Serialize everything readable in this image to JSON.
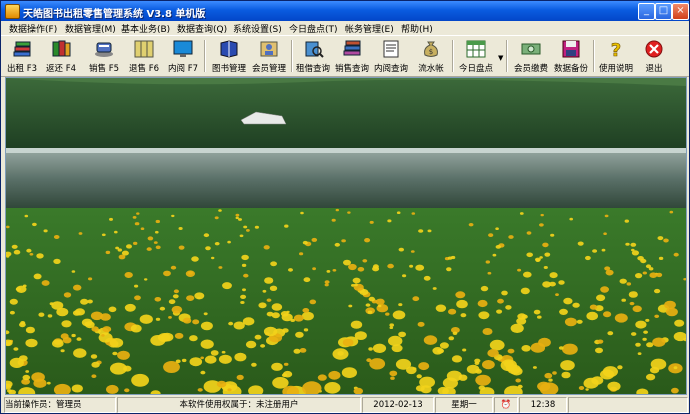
{
  "window": {
    "title": "天皓图书出租零售管理系统 V3.8 单机版"
  },
  "menu": [
    {
      "label": "数据操作(F)"
    },
    {
      "label": "数据管理(M)"
    },
    {
      "label": "基本业务(B)"
    },
    {
      "label": "数据查询(Q)"
    },
    {
      "label": "系统设置(S)"
    },
    {
      "label": "今日盘点(T)"
    },
    {
      "label": "帐务管理(E)"
    },
    {
      "label": "帮助(H)"
    }
  ],
  "toolbar": [
    {
      "label": "出租 F3",
      "icon": "book-stack-icon"
    },
    {
      "label": "返还 F4",
      "icon": "book-return-icon"
    },
    {
      "label": "销售 F5",
      "icon": "books-sale-icon"
    },
    {
      "label": "退售 F6",
      "icon": "books-shelf-icon"
    },
    {
      "label": "内阅 F7",
      "icon": "monitor-icon"
    },
    {
      "label": "图书管理",
      "icon": "book-manage-icon"
    },
    {
      "label": "会员管理",
      "icon": "member-icon"
    },
    {
      "label": "租借查询",
      "icon": "rent-query-icon"
    },
    {
      "label": "销售查询",
      "icon": "sale-query-icon"
    },
    {
      "label": "内阅查询",
      "icon": "read-query-icon"
    },
    {
      "label": "流水帐",
      "icon": "money-bag-icon"
    },
    {
      "label": "今日盘点",
      "icon": "spreadsheet-icon"
    },
    {
      "label": "会员缴费",
      "icon": "cash-icon"
    },
    {
      "label": "数据备份",
      "icon": "floppy-icon"
    },
    {
      "label": "使用说明",
      "icon": "help-icon"
    },
    {
      "label": "退出",
      "icon": "exit-icon"
    }
  ],
  "status": {
    "operator": "当前操作员：管理员",
    "license": "本软件使用权属于：未注册用户",
    "date": "2012-02-13",
    "weekday": "星期一",
    "time": "12:38"
  },
  "colors": {
    "title_bar": "#0a5ce0",
    "window_bg": "#ece9d8"
  }
}
